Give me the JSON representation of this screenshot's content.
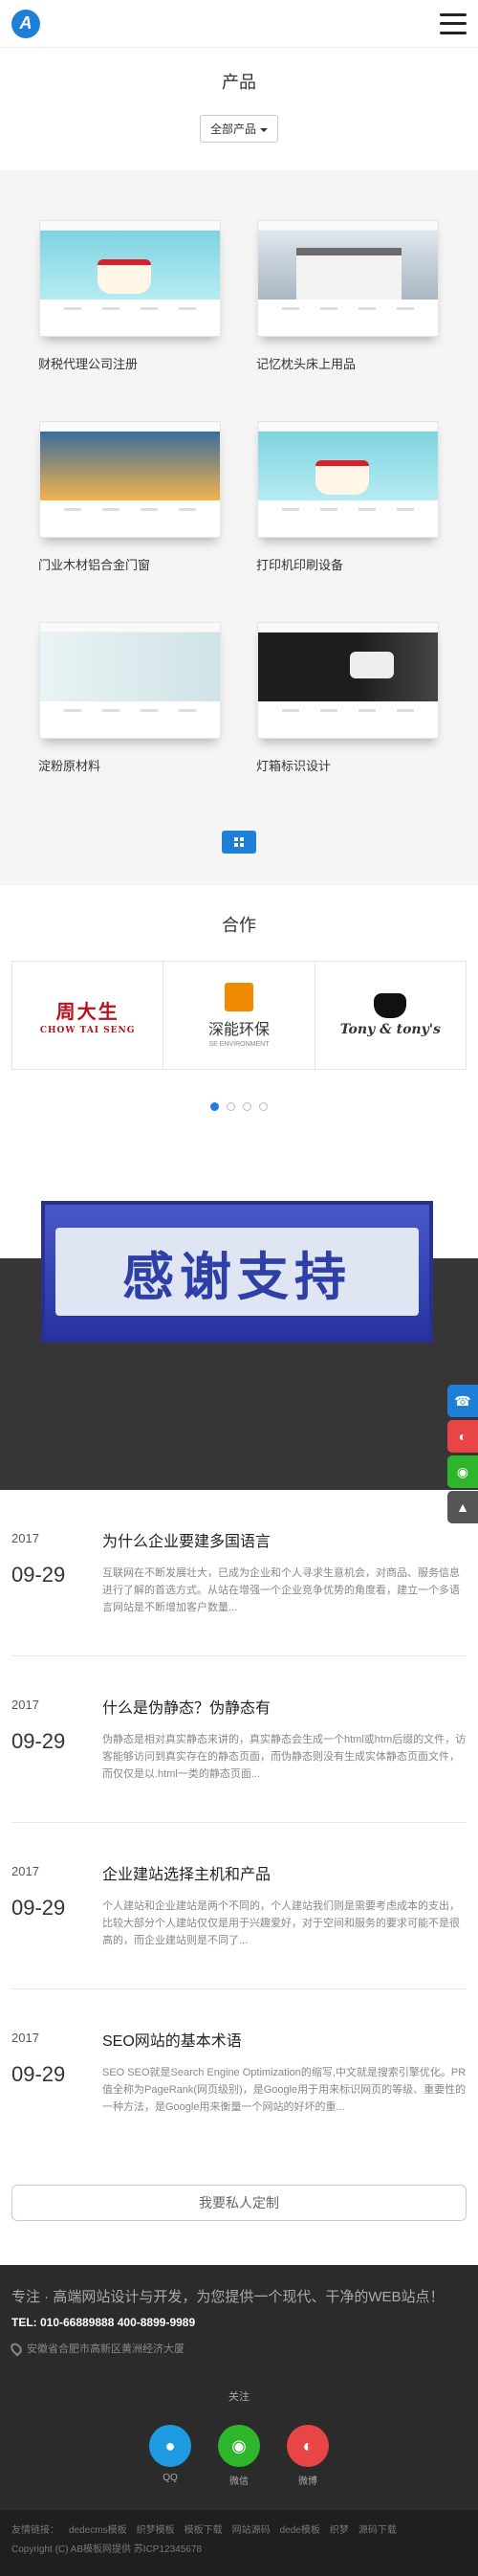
{
  "header": {
    "logo_text": "A",
    "menu_icon": "hamburger-icon"
  },
  "products": {
    "title": "产品",
    "filter_label": "全部产品",
    "items": [
      {
        "label": "财税代理公司注册"
      },
      {
        "label": "记忆枕头床上用品"
      },
      {
        "label": "门业木材铝合金门窗"
      },
      {
        "label": "打印机印刷设备"
      },
      {
        "label": "淀粉原材料"
      },
      {
        "label": "灯箱标识设计"
      }
    ],
    "more_icon": "grid-icon"
  },
  "partners": {
    "title": "合作",
    "items": [
      {
        "cn": "周大生",
        "en": "CHOW TAI SENG"
      },
      {
        "cn": "深能环保",
        "en": "SE ENVIRONMENT"
      },
      {
        "cn": "Tony & tony's"
      }
    ]
  },
  "thanks_banner": {
    "text": "感谢支持"
  },
  "news": {
    "items": [
      {
        "year": "2017",
        "date": "09-29",
        "title": "为什么企业要建多国语言",
        "desc": "互联网在不断发展壮大，已成为企业和个人寻求生意机会，对商品、服务信息进行了解的首选方式。从站在增强一个企业竞争优势的角度看，建立一个多语言网站是不断增加客户数量..."
      },
      {
        "year": "2017",
        "date": "09-29",
        "title": "什么是伪静态？伪静态有",
        "desc": "伪静态是相对真实静态来讲的，真实静态会生成一个html或htm后缀的文件，访客能够访问到真实存在的静态页面，而伪静态则没有生成实体静态页面文件，而仅仅是以.html一类的静态页面..."
      },
      {
        "year": "2017",
        "date": "09-29",
        "title": "企业建站选择主机和产品",
        "desc": "个人建站和企业建站是两个不同的，个人建站我们则是需要考虑成本的支出，比较大部分个人建站仅仅是用于兴趣爱好，对于空间和服务的要求可能不是很高的，而企业建站则是不同了..."
      },
      {
        "year": "2017",
        "date": "09-29",
        "title": "SEO网站的基本术语",
        "desc": "SEO SEO就是Search Engine Optimization的缩写,中文就是搜索引擎优化。PR 值全称为PageRank(网页级别)，是Google用于用来标识网页的等级、重要性的一种方法，是Google用来衡量一个网站的好坏的重..."
      }
    ],
    "custom_button": "我要私人定制"
  },
  "footer": {
    "slogan": "专注 · 高端网站设计与开发，为您提供一个现代、干净的WEB站点！",
    "tel": "TEL: 010-66889888 400-8899-9989",
    "address": "安徽省合肥市高新区黄洲经济大厦",
    "follow": "关注",
    "socials": [
      {
        "label": "QQ",
        "icon": "qq-icon",
        "color": "#1e9be0"
      },
      {
        "label": "微信",
        "icon": "wechat-icon",
        "color": "#2db52c"
      },
      {
        "label": "微博",
        "icon": "weibo-icon",
        "color": "#e84646"
      }
    ],
    "links_label": "友情链接：",
    "links": [
      "dedecms模板",
      "织梦模板",
      "模板下载",
      "网站源码",
      "dede模板",
      "织梦",
      "源码下载"
    ],
    "copyright": "Copyright (C) AB模板网提供 苏ICP12345678"
  },
  "side_tools": [
    {
      "icon": "phone-icon",
      "color": "#1e7fd8"
    },
    {
      "icon": "weibo-icon",
      "color": "#e84646"
    },
    {
      "icon": "wechat-icon",
      "color": "#2db52c"
    },
    {
      "icon": "arrow-up-icon",
      "color": "#555555"
    }
  ]
}
